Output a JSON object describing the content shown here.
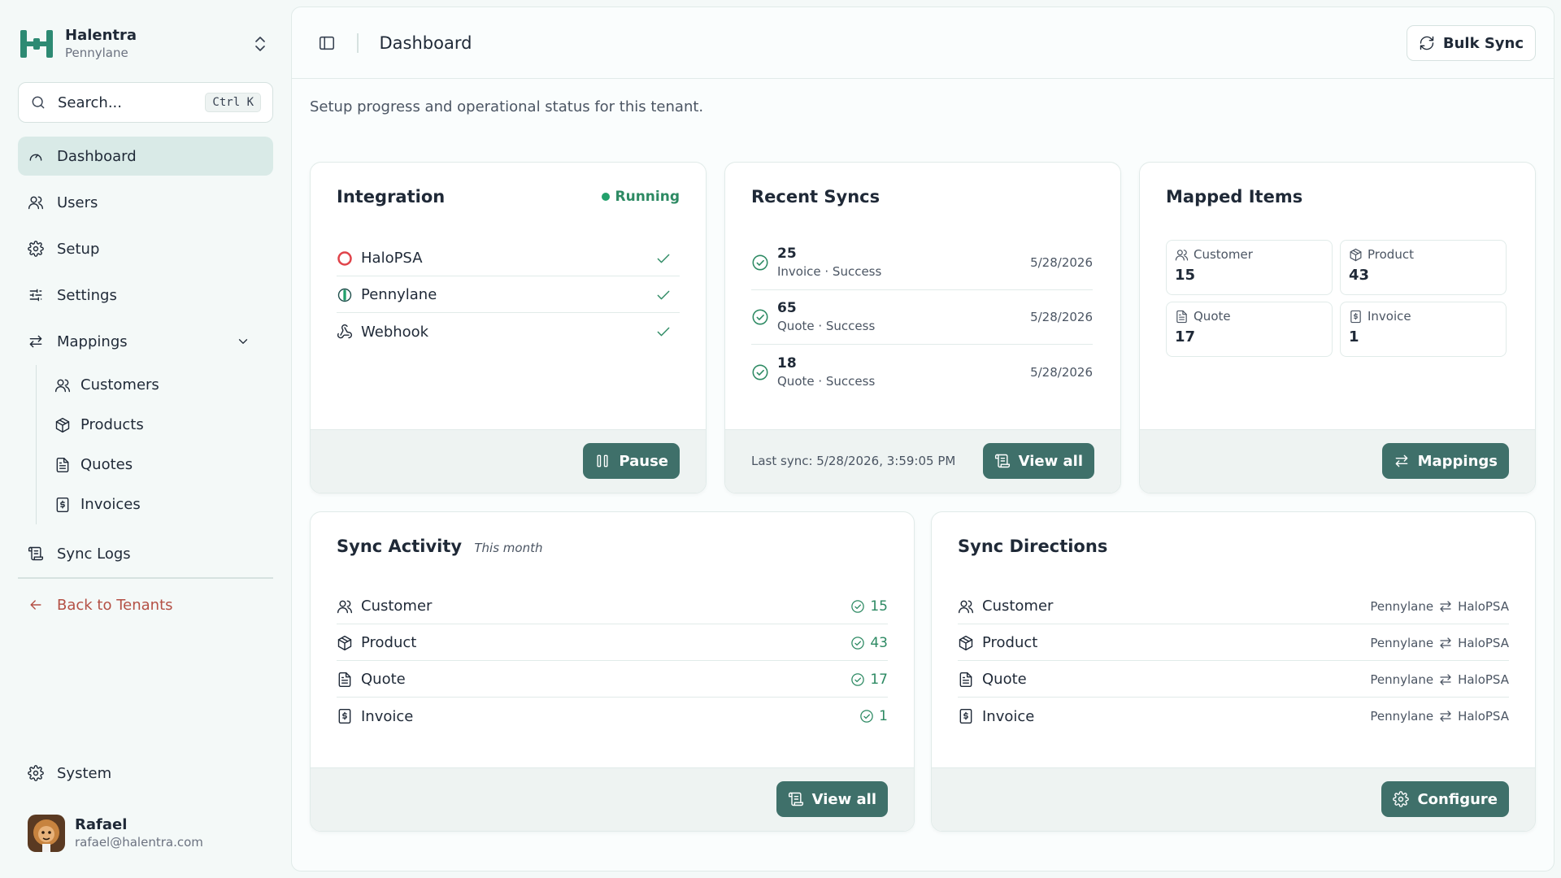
{
  "brand": {
    "name": "Halentra",
    "tenant": "Pennylane"
  },
  "search": {
    "label": "Search...",
    "shortcut": "Ctrl K"
  },
  "nav": {
    "dashboard": "Dashboard",
    "users": "Users",
    "setup": "Setup",
    "settings": "Settings",
    "mappings": "Mappings",
    "mappings_sub": {
      "customers": "Customers",
      "products": "Products",
      "quotes": "Quotes",
      "invoices": "Invoices"
    },
    "sync_logs": "Sync Logs",
    "back": "Back to Tenants",
    "system": "System"
  },
  "user": {
    "name": "Rafael",
    "email": "rafael@halentra.com"
  },
  "header": {
    "title": "Dashboard",
    "bulk_sync": "Bulk Sync"
  },
  "subtitle": "Setup progress and operational status for this tenant.",
  "integration": {
    "title": "Integration",
    "status": "Running",
    "items": [
      "HaloPSA",
      "Pennylane",
      "Webhook"
    ],
    "pause_label": "Pause"
  },
  "recent_syncs": {
    "title": "Recent Syncs",
    "items": [
      {
        "count": "25",
        "meta": "Invoice · Success",
        "date": "5/28/2026"
      },
      {
        "count": "65",
        "meta": "Quote · Success",
        "date": "5/28/2026"
      },
      {
        "count": "18",
        "meta": "Quote · Success",
        "date": "5/28/2026"
      }
    ],
    "last_sync": "Last sync: 5/28/2026, 3:59:05 PM",
    "view_all": "View all"
  },
  "mapped_items": {
    "title": "Mapped Items",
    "tiles": [
      {
        "label": "Customer",
        "value": "15"
      },
      {
        "label": "Product",
        "value": "43"
      },
      {
        "label": "Quote",
        "value": "17"
      },
      {
        "label": "Invoice",
        "value": "1"
      }
    ],
    "button": "Mappings"
  },
  "sync_activity": {
    "title": "Sync Activity",
    "period": "This month",
    "rows": [
      {
        "label": "Customer",
        "count": "15"
      },
      {
        "label": "Product",
        "count": "43"
      },
      {
        "label": "Quote",
        "count": "17"
      },
      {
        "label": "Invoice",
        "count": "1"
      }
    ],
    "view_all": "View all"
  },
  "sync_directions": {
    "title": "Sync Directions",
    "rows": [
      {
        "label": "Customer",
        "from": "Pennylane",
        "to": "HaloPSA"
      },
      {
        "label": "Product",
        "from": "Pennylane",
        "to": "HaloPSA"
      },
      {
        "label": "Quote",
        "from": "Pennylane",
        "to": "HaloPSA"
      },
      {
        "label": "Invoice",
        "from": "Pennylane",
        "to": "HaloPSA"
      }
    ],
    "button": "Configure"
  },
  "colors": {
    "accent": "#3f706a",
    "success": "#2d8a63",
    "danger": "#b45045",
    "active_nav": "#d9eae7"
  }
}
